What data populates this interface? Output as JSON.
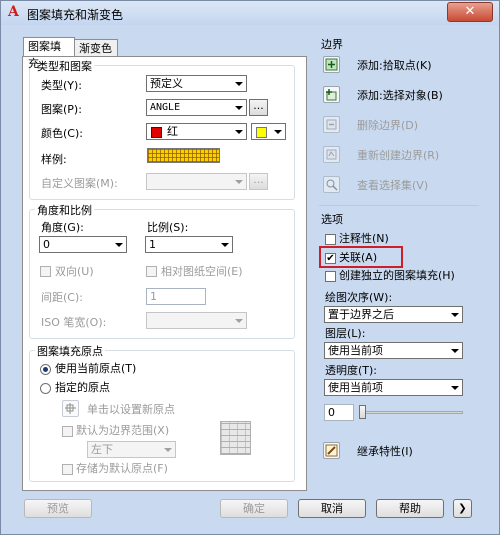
{
  "window": {
    "title": "图案填充和渐变色",
    "app_icon": "A",
    "close": "✕"
  },
  "tabs": [
    "图案填充",
    "渐变色"
  ],
  "type_pattern": {
    "group": "类型和图案",
    "type_label": "类型(Y):",
    "type_value": "预定义",
    "pattern_label": "图案(P):",
    "pattern_value": "ANGLE",
    "color_label": "颜色(C):",
    "color_value": "红",
    "swatch_label": "样例:",
    "custom_label": "自定义图案(M):",
    "color_primary": "#e00000",
    "color_secondary": "#ffff00",
    "swatch_color": "#f4d200"
  },
  "angle_scale": {
    "group": "角度和比例",
    "angle_label": "角度(G):",
    "angle_value": "0",
    "scale_label": "比例(S):",
    "scale_value": "1",
    "double_label": "双向(U)",
    "relative_label": "相对图纸空间(E)",
    "spacing_label": "间距(C):",
    "spacing_value": "1",
    "iso_label": "ISO 笔宽(O):"
  },
  "origin": {
    "group": "图案填充原点",
    "use_current": "使用当前原点(T)",
    "specified": "指定的原点",
    "click_set": "单击以设置新原点",
    "default_extent": "默认为边界范围(X)",
    "extent_value": "左下",
    "store_default": "存储为默认原点(F)"
  },
  "boundaries": {
    "group": "边界",
    "add_pick": "添加:拾取点(K)",
    "add_select": "添加:选择对象(B)",
    "remove": "删除边界(D)",
    "recreate": "重新创建边界(R)",
    "view_selection": "查看选择集(V)"
  },
  "options": {
    "group": "选项",
    "annotative": "注释性(N)",
    "associative": "关联(A)",
    "independent": "创建独立的图案填充(H)",
    "draw_order_label": "绘图次序(W):",
    "draw_order_value": "置于边界之后",
    "layer_label": "图层(L):",
    "layer_value": "使用当前项",
    "transparency_label": "透明度(T):",
    "transparency_value": "使用当前项",
    "transparency_number": "0",
    "transparency_level": 0
  },
  "inherit": "继承特性(I)",
  "buttons": {
    "preview": "预览",
    "ok": "确定",
    "cancel": "取消",
    "help": "帮助",
    "expand": "❯"
  }
}
